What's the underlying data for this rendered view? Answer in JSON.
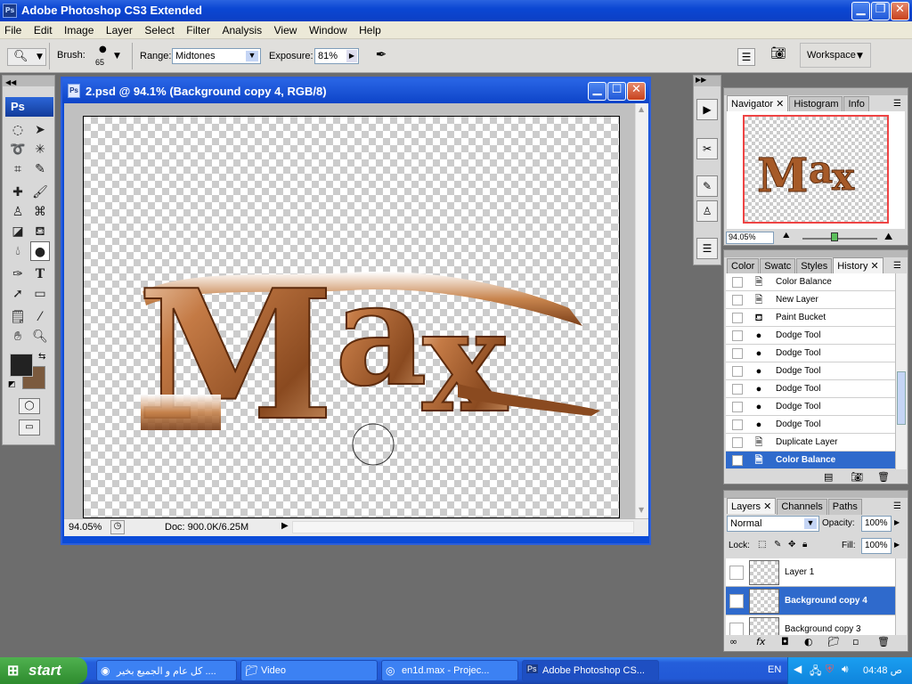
{
  "app": {
    "title": "Adobe Photoshop CS3 Extended",
    "logo": "Ps"
  },
  "menu": [
    "File",
    "Edit",
    "Image",
    "Layer",
    "Select",
    "Filter",
    "Analysis",
    "View",
    "Window",
    "Help"
  ],
  "options": {
    "brush_label": "Brush:",
    "brush_size": "65",
    "range_label": "Range:",
    "range_value": "Midtones",
    "exposure_label": "Exposure:",
    "exposure_value": "81%",
    "workspace_label": "Workspace"
  },
  "document": {
    "title": "2.psd @ 94.1% (Background copy 4, RGB/8)",
    "zoom": "94.05%",
    "doc_info": "Doc: 900.0K/6.25M"
  },
  "artwork": {
    "text": "Max",
    "letters": [
      "M",
      "a",
      "x"
    ]
  },
  "navigator": {
    "tabs": [
      "Navigator",
      "Histogram",
      "Info"
    ],
    "zoom": "94.05%"
  },
  "history_panel": {
    "tabs": [
      "Color",
      "Swatc",
      "Styles",
      "History"
    ],
    "items": [
      {
        "label": "Color Balance",
        "icon": "doc-icon"
      },
      {
        "label": "New Layer",
        "icon": "doc-icon"
      },
      {
        "label": "Paint Bucket",
        "icon": "bucket-icon"
      },
      {
        "label": "Dodge Tool",
        "icon": "dodge-icon"
      },
      {
        "label": "Dodge Tool",
        "icon": "dodge-icon"
      },
      {
        "label": "Dodge Tool",
        "icon": "dodge-icon"
      },
      {
        "label": "Dodge Tool",
        "icon": "dodge-icon"
      },
      {
        "label": "Dodge Tool",
        "icon": "dodge-icon"
      },
      {
        "label": "Dodge Tool",
        "icon": "dodge-icon"
      },
      {
        "label": "Duplicate Layer",
        "icon": "doc-icon"
      },
      {
        "label": "Color Balance",
        "icon": "doc-icon",
        "selected": true
      }
    ]
  },
  "layers_panel": {
    "tabs": [
      "Layers",
      "Channels",
      "Paths"
    ],
    "blend_mode": "Normal",
    "opacity_label": "Opacity:",
    "opacity_value": "100%",
    "lock_label": "Lock:",
    "fill_label": "Fill:",
    "fill_value": "100%",
    "layers": [
      {
        "name": "Layer 1",
        "visible": false
      },
      {
        "name": "Background copy 4",
        "visible": true,
        "selected": true
      },
      {
        "name": "Background copy 3",
        "visible": false
      }
    ]
  },
  "taskbar": {
    "start_label": "start",
    "tasks": [
      "كل عام و الجميع بخير ....",
      "Video",
      "en1d.max - Projec...",
      "Adobe Photoshop CS..."
    ],
    "language": "EN",
    "clock": "04:48 ص"
  },
  "colors": {
    "accent": "#2f6acc",
    "title_blue": "#0b47d3",
    "foreground": "#222222",
    "background_swatch": "#7b5a3e"
  }
}
